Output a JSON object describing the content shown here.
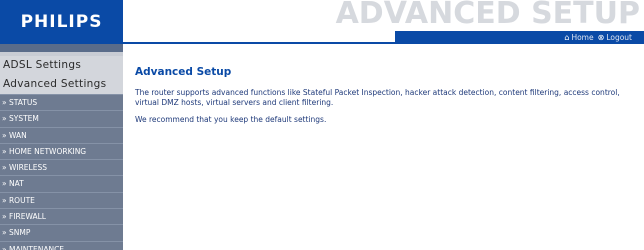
{
  "header": {
    "brand": "PHILIPS",
    "section_title": "ADVANCED SETUP",
    "home_label": "Home",
    "logout_label": "Logout"
  },
  "sidebar": {
    "headings": [
      "ADSL Settings",
      "Advanced Settings"
    ],
    "items": [
      "» STATUS",
      "» SYSTEM",
      "» WAN",
      "» HOME NETWORKING",
      "» WIRELESS",
      "» NAT",
      "» ROUTE",
      "» FIREWALL",
      "» SNMP",
      "» MAINTENANCE"
    ]
  },
  "main": {
    "title": "Advanced Setup",
    "paragraphs": [
      "The router supports advanced functions like Stateful Packet Inspection, hacker attack detection, content filtering, access control, virtual DMZ hosts, virtual servers and client filtering.",
      "We recommend that you keep the default settings."
    ]
  },
  "colors": {
    "brand_blue": "#0a4aa6",
    "sidebar_item_bg": "#6e7b91",
    "sidebar_bg": "#c8ccd4"
  },
  "icons": {
    "home": "home-icon",
    "logout": "logout-icon"
  }
}
